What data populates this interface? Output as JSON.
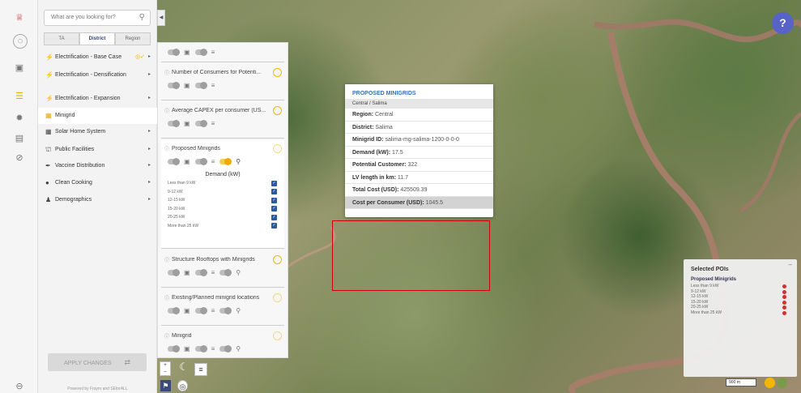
{
  "search": {
    "placeholder": "What are you looking for?"
  },
  "tabs": [
    "TA",
    "District",
    "Region"
  ],
  "menu": [
    {
      "label": "Electrification - Base Case"
    },
    {
      "label": "Electrification - Densification"
    },
    {
      "label": "Electrification - Expansion"
    },
    {
      "label": "Minigrid"
    },
    {
      "label": "Solar Home System"
    },
    {
      "label": "Public Facilities"
    },
    {
      "label": "Vaccine Distribution"
    },
    {
      "label": "Clean Cooking"
    },
    {
      "label": "Demographics"
    }
  ],
  "apply_label": "APPLY CHANGES",
  "powered": "Powered by Fraym and SEforALL",
  "layers": {
    "consumers": "Number of Consumers for Potenti...",
    "capex": "Average CAPEX per consumer (US...",
    "proposed": "Proposed Minigrids",
    "legend_title": "Demand (kW)",
    "legend": [
      "Less than 9 kW",
      "9-12 kW",
      "12-15 kW",
      "15-20 kW",
      "20-25 kW",
      "More than 25 kW"
    ],
    "rooftops": "Structure Rooftops with Minigrids",
    "existing": "Existing/Planned minigrid locations",
    "minigrid": "Minigrid"
  },
  "popup": {
    "title": "PROPOSED MINIGRIDS",
    "sub": "Central / Salima",
    "rows": [
      {
        "k": "Region:",
        "v": "Central"
      },
      {
        "k": "District:",
        "v": "Salima"
      },
      {
        "k": "Minigrid ID:",
        "v": "salima-mg-salima-1200-0-0-0"
      },
      {
        "k": "Demand (kW):",
        "v": "17.5"
      },
      {
        "k": "Potential Customer:",
        "v": "322"
      },
      {
        "k": "LV length in km:",
        "v": "11.7"
      },
      {
        "k": "Total Cost (USD):",
        "v": "425509.39"
      },
      {
        "k": "Cost per Consumer (USD):",
        "v": "1045.5"
      }
    ]
  },
  "poi": {
    "title": "Selected POIs",
    "sub": "Proposed Minigrids",
    "items": [
      "Less than 9 kW",
      "9-12 kW",
      "12-15 kW",
      "15-20 kW",
      "20-25 kW",
      "More than 25 kW"
    ]
  },
  "help": "?",
  "scale": "900 m",
  "colors": {
    "accent": "#f2a900",
    "popup_title": "#3a70b8",
    "poi_dot": "#d32f2f",
    "help": "#5863c7"
  }
}
